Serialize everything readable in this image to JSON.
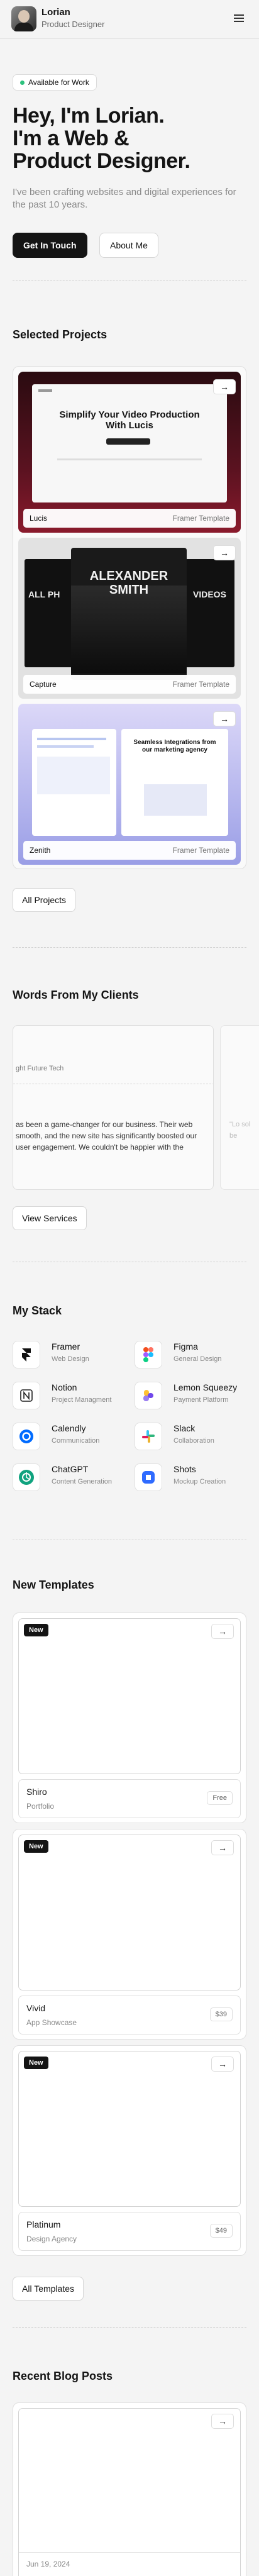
{
  "header": {
    "name": "Lorian",
    "role": "Product Designer",
    "menu_icon": "hamburger-icon"
  },
  "hero": {
    "badge": "Available for Work",
    "line1": "Hey, I'm Lorian.",
    "line2": "I'm a Web &",
    "line3": "Product Designer.",
    "subtitle": "I've been crafting websites and digital experiences for the past 10 years.",
    "primary_cta": "Get In Touch",
    "secondary_cta": "About Me"
  },
  "projects": {
    "title": "Selected Projects",
    "items": [
      {
        "name": "Lucis",
        "type": "Framer Template",
        "headline": "Simplify Your Video Production With Lucis"
      },
      {
        "name": "Capture",
        "type": "Framer Template",
        "headline": "ALEXANDER SMITH",
        "left": "ALL PH",
        "right": "VIDEOS"
      },
      {
        "name": "Zenith",
        "type": "Framer Template",
        "headline": "Seamless Integrations from our marketing agency"
      }
    ],
    "all_button": "All Projects"
  },
  "testimonials": {
    "title": "Words From My Clients",
    "company": "ght Future Tech",
    "quote": "as been a game-changer for our business. Their web smooth, and the new site has significantly boosted our user engagement. We couldn't be happier with the",
    "peek_text": "\"Lo sol be",
    "button": "View Services"
  },
  "stack": {
    "title": "My Stack",
    "items": [
      {
        "name": "Framer",
        "desc": "Web Design",
        "icon": "framer-icon"
      },
      {
        "name": "Figma",
        "desc": "General Design",
        "icon": "figma-icon"
      },
      {
        "name": "Notion",
        "desc": "Project Managment",
        "icon": "notion-icon"
      },
      {
        "name": "Lemon Squeezy",
        "desc": "Payment Platform",
        "icon": "lemon-squeezy-icon"
      },
      {
        "name": "Calendly",
        "desc": "Communication",
        "icon": "calendly-icon"
      },
      {
        "name": "Slack",
        "desc": "Collaboration",
        "icon": "slack-icon"
      },
      {
        "name": "ChatGPT",
        "desc": "Content Generation",
        "icon": "chatgpt-icon"
      },
      {
        "name": "Shots",
        "desc": "Mockup Creation",
        "icon": "shots-icon"
      }
    ]
  },
  "templates": {
    "title": "New Templates",
    "badge": "New",
    "items": [
      {
        "name": "Shiro",
        "category": "Portfolio",
        "price": "Free"
      },
      {
        "name": "Vivid",
        "category": "App Showcase",
        "price": "$39"
      },
      {
        "name": "Platinum",
        "category": "Design Agency",
        "price": "$49"
      }
    ],
    "all_button": "All Templates"
  },
  "blog": {
    "title": "Recent Blog Posts",
    "date": "Jun 19, 2024"
  },
  "colors": {
    "accent": "#141414",
    "status": "#2ec27e",
    "background": "#f4f4f4"
  }
}
